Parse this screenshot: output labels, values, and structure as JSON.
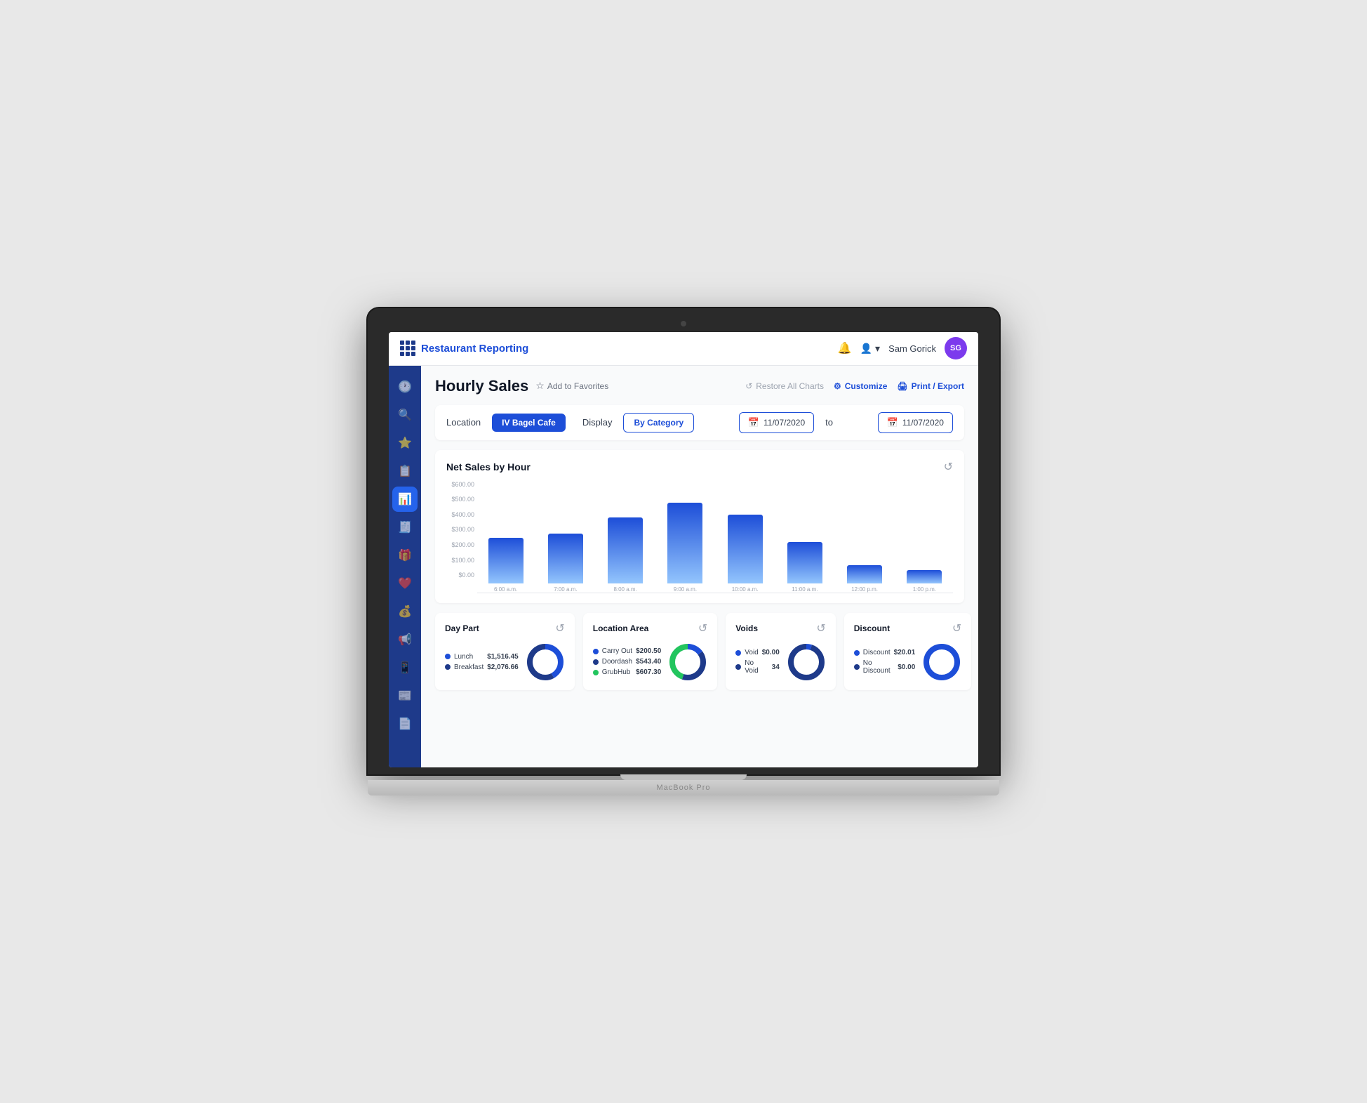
{
  "laptop": {
    "brand": "MacBook Pro"
  },
  "topbar": {
    "app_title": "Restaurant Reporting",
    "bell_icon": "🔔",
    "user_name": "Sam Gorick",
    "avatar_initials": "SG",
    "avatar_color": "#7c3aed"
  },
  "sidebar": {
    "items": [
      {
        "icon": "🕐",
        "label": "Clock",
        "active": false
      },
      {
        "icon": "🔍",
        "label": "Search",
        "active": false
      },
      {
        "icon": "⭐",
        "label": "Favorites",
        "active": false
      },
      {
        "icon": "📋",
        "label": "Reports",
        "active": false
      },
      {
        "icon": "📊",
        "label": "Analytics",
        "active": true
      },
      {
        "icon": "🧾",
        "label": "Receipts",
        "active": false
      },
      {
        "icon": "🎁",
        "label": "Gifts",
        "active": false
      },
      {
        "icon": "❤️",
        "label": "Favorites2",
        "active": false
      },
      {
        "icon": "💰",
        "label": "Money",
        "active": false
      },
      {
        "icon": "📢",
        "label": "Marketing",
        "active": false
      },
      {
        "icon": "📱",
        "label": "Mobile",
        "active": false
      },
      {
        "icon": "📰",
        "label": "News",
        "active": false
      },
      {
        "icon": "📄",
        "label": "Document",
        "active": false
      }
    ]
  },
  "page": {
    "title": "Hourly Sales",
    "add_to_favorites": "Add to Favorites",
    "restore_btn": "Restore All Charts",
    "customize_btn": "Customize",
    "print_btn": "Print / Export"
  },
  "filters": {
    "location_label": "Location",
    "location_value": "IV Bagel Cafe",
    "display_label": "Display",
    "display_value": "By Category",
    "date_from": "11/07/2020",
    "date_to": "11/07/2020",
    "to_label": "to"
  },
  "bar_chart": {
    "title": "Net Sales by Hour",
    "y_labels": [
      "$0.00",
      "$100.00",
      "$200.00",
      "$300.00",
      "$400.00",
      "$500.00",
      "$600.00"
    ],
    "bars": [
      {
        "label": "6:00 a.m.",
        "height_pct": 50
      },
      {
        "label": "7:00 a.m.",
        "height_pct": 54
      },
      {
        "label": "8:00 a.m.",
        "height_pct": 72
      },
      {
        "label": "9:00 a.m.",
        "height_pct": 88
      },
      {
        "label": "10:00 a.m.",
        "height_pct": 75
      },
      {
        "label": "11:00 a.m.",
        "height_pct": 45
      },
      {
        "label": "12:00 p.m.",
        "height_pct": 20
      },
      {
        "label": "1:00 p.m.",
        "height_pct": 14
      }
    ]
  },
  "mini_cards": [
    {
      "title": "Day Part",
      "items": [
        {
          "label": "Lunch",
          "color": "#1d4ed8",
          "value": "$1,516.45"
        },
        {
          "label": "Breakfast",
          "color": "#1e3a8a",
          "value": "$2,076.66"
        }
      ],
      "donut": [
        {
          "color": "#1d4ed8",
          "pct": 42
        },
        {
          "color": "#1e3a8a",
          "pct": 58
        }
      ]
    },
    {
      "title": "Location Area",
      "items": [
        {
          "label": "Carry Out",
          "color": "#1d4ed8",
          "value": "$200.50"
        },
        {
          "label": "Doordash",
          "color": "#1e3a8a",
          "value": "$543.40"
        },
        {
          "label": "GrubHub",
          "color": "#22c55e",
          "value": "$607.30"
        }
      ],
      "donut": [
        {
          "color": "#1d4ed8",
          "pct": 15
        },
        {
          "color": "#1e3a8a",
          "pct": 40
        },
        {
          "color": "#22c55e",
          "pct": 45
        }
      ]
    },
    {
      "title": "Voids",
      "items": [
        {
          "label": "Void",
          "color": "#1d4ed8",
          "value": "$0.00"
        },
        {
          "label": "No Void",
          "color": "#1e3a8a",
          "value": "34"
        }
      ],
      "donut": [
        {
          "color": "#1d4ed8",
          "pct": 5
        },
        {
          "color": "#1e3a8a",
          "pct": 95
        }
      ]
    },
    {
      "title": "Discount",
      "items": [
        {
          "label": "Discount",
          "color": "#1d4ed8",
          "value": "$20.01"
        },
        {
          "label": "No Discount",
          "color": "#1e3a8a",
          "value": "$0.00"
        }
      ],
      "donut": [
        {
          "color": "#1d4ed8",
          "pct": 100
        },
        {
          "color": "#1e3a8a",
          "pct": 0
        }
      ]
    }
  ]
}
